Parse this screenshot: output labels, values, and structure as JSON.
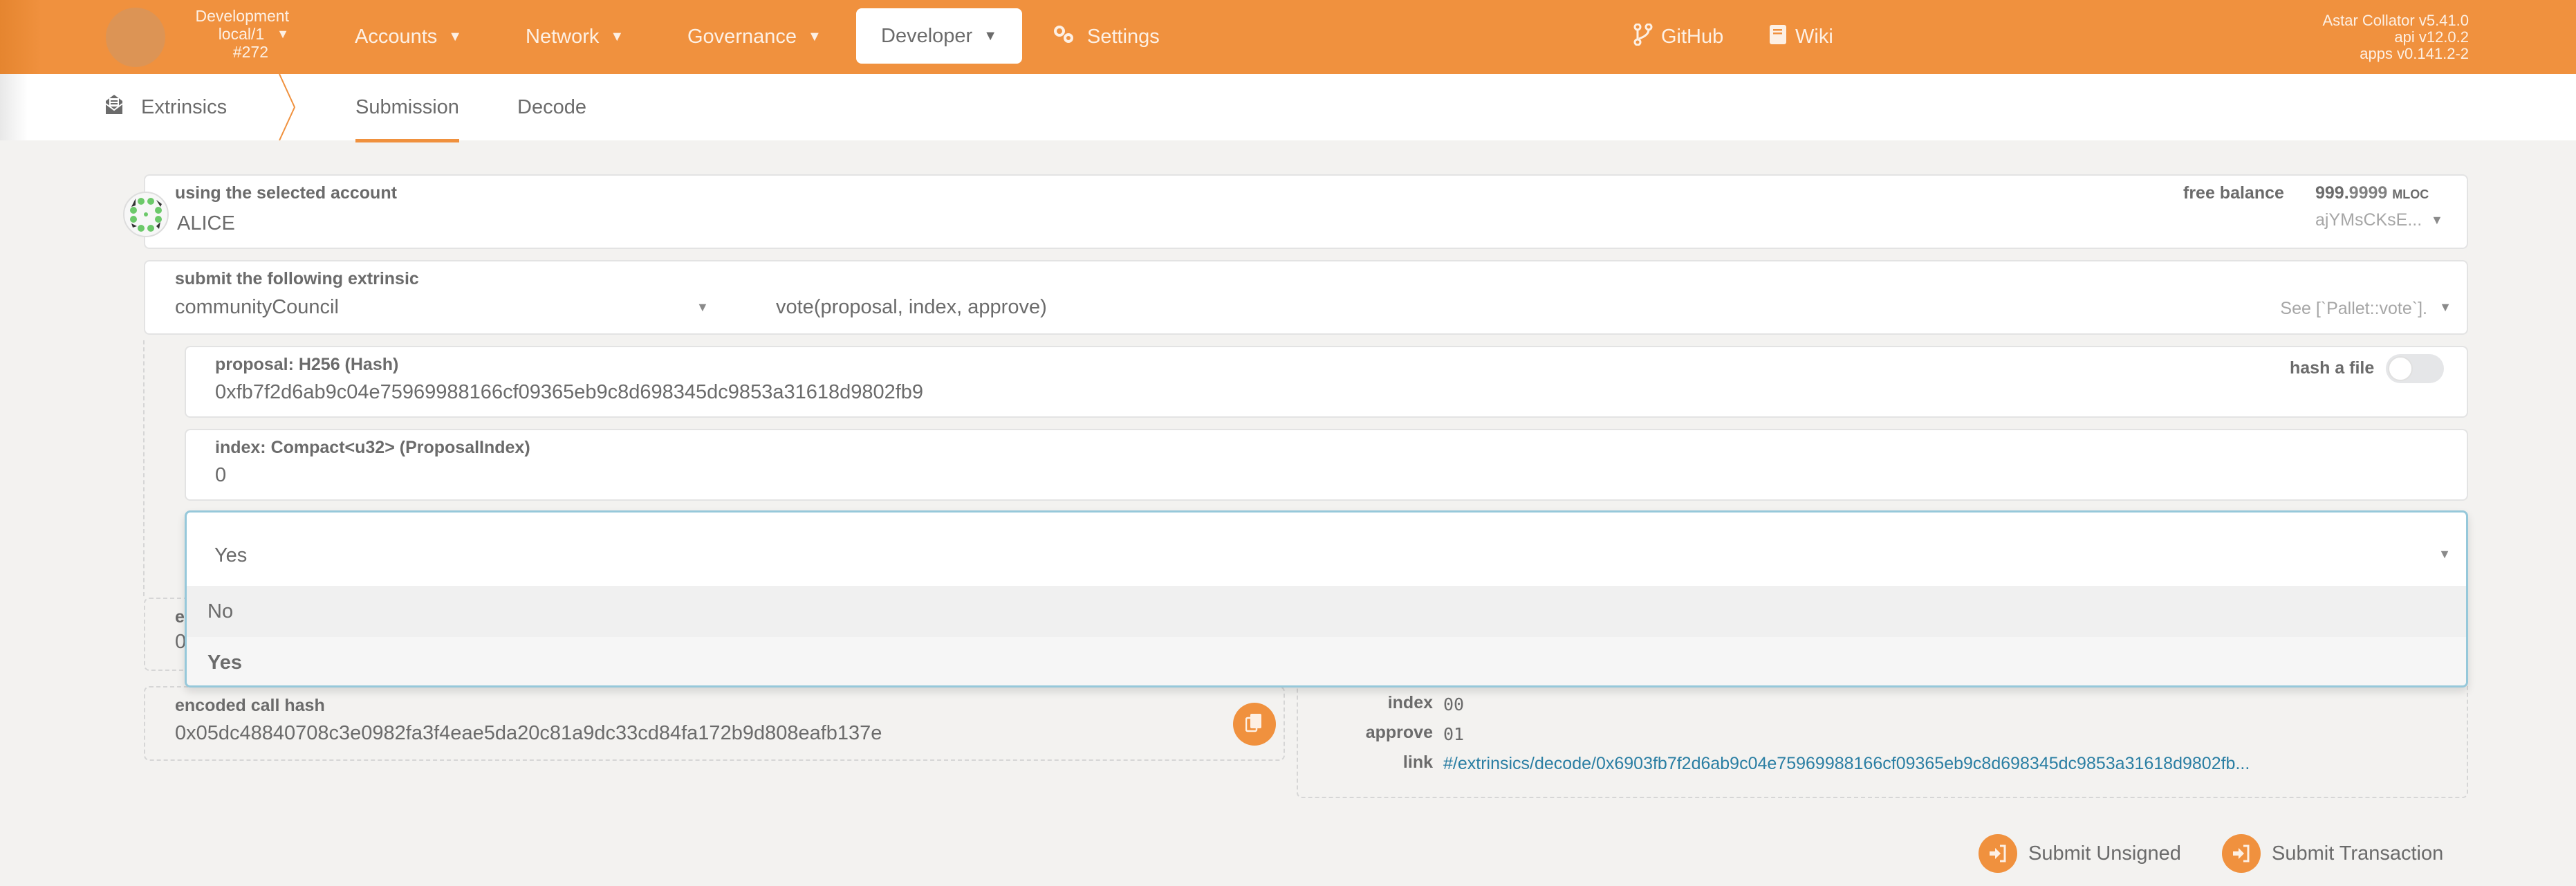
{
  "topbar": {
    "chain": {
      "name": "Development",
      "endpoint": "local/1",
      "block": "#272"
    },
    "nav": [
      {
        "label": "Accounts",
        "icon": "chevron-down-icon"
      },
      {
        "label": "Network",
        "icon": "chevron-down-icon"
      },
      {
        "label": "Governance",
        "icon": "chevron-down-icon"
      },
      {
        "label": "Developer",
        "icon": "chevron-down-icon",
        "active": true
      },
      {
        "label": "Settings",
        "icon": "gears-icon"
      }
    ],
    "links": [
      {
        "label": "GitHub",
        "icon": "code-branch-icon"
      },
      {
        "label": "Wiki",
        "icon": "book-icon"
      }
    ],
    "version": {
      "node": "Astar Collator v5.41.0",
      "api": "api v12.0.2",
      "apps": "apps v0.141.2-2"
    }
  },
  "tabs": {
    "section": "Extrinsics",
    "items": [
      {
        "label": "Submission",
        "active": true
      },
      {
        "label": "Decode",
        "active": false
      }
    ]
  },
  "account": {
    "label": "using the selected account",
    "name": "ALICE",
    "balance_label": "free balance",
    "balance_int": "999.",
    "balance_dec": "9999",
    "balance_unit": "MLOC",
    "address_short": "ajYMsCKsE..."
  },
  "extrinsic": {
    "label": "submit the following extrinsic",
    "pallet": "communityCouncil",
    "method": "vote(proposal, index, approve)",
    "doc": "See [`Pallet::vote`]."
  },
  "params": {
    "proposal": {
      "label": "proposal: H256 (Hash)",
      "value": "0xfb7f2d6ab9c04e75969988166cf09365eb9c8d698345dc9853a31618d9802fb9",
      "hash_file_label": "hash a file",
      "hash_file_on": false
    },
    "index": {
      "label": "index: Compact<u32> (ProposalIndex)",
      "value": "0"
    },
    "approve": {
      "selected": "Yes",
      "options": [
        {
          "label": "No",
          "selected": false
        },
        {
          "label": "Yes",
          "selected": true
        }
      ]
    }
  },
  "encoded": {
    "partial_label": "e",
    "partial_value": "0",
    "call_hash_label": "encoded call hash",
    "call_hash": "0x05dc48840708c3e0982fa3f4eae5da20c81a9dc33cd84fa172b9d808eafb137e",
    "copy_icon": "copy-icon"
  },
  "decoded": {
    "rows": [
      {
        "label": "index",
        "value": "00"
      },
      {
        "label": "approve",
        "value": "01"
      }
    ],
    "link_label": "link",
    "link": "#/extrinsics/decode/0x6903fb7f2d6ab9c04e75969988166cf09365eb9c8d698345dc9853a31618d9802fb..."
  },
  "actions": {
    "submit_unsigned": "Submit Unsigned",
    "submit_transaction": "Submit Transaction"
  },
  "colors": {
    "accent": "#f0913e",
    "link": "#2a7ea3",
    "focus_border": "#96c8da"
  }
}
